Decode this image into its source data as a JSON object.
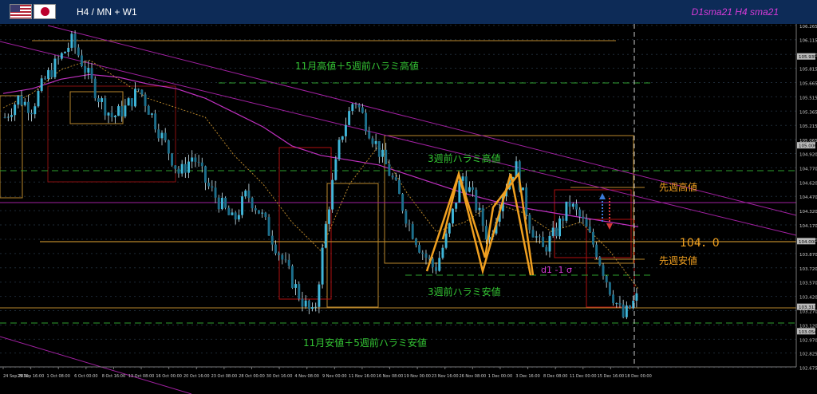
{
  "header": {
    "title": "H4 / MN + W1",
    "legend_d1": "D1sma21",
    "legend_h4": "H4 sma21",
    "flags": [
      "flag-us-icon",
      "flag-jp-icon"
    ]
  },
  "annotations": {
    "nov_high": "11月高値＋5週前ハラミ高値",
    "harami3_high": "3週前ハラミ高値",
    "prev_week_high": "先週高値",
    "level_104": "104．0",
    "prev_week_low": "先週安値",
    "d1_sigma": "d1 -1 σ",
    "harami3_low": "3週前ハラミ安値",
    "nov_low": "11月安値＋5週前ハラミ安値"
  },
  "colors": {
    "background": "#000000",
    "header": "#0d2b57",
    "grid": "#2a3a4a",
    "candle": "#3fb6d9",
    "sma_d1": "#c030c0",
    "sma_h4": "#b8862b",
    "annotation_green": "#33c233",
    "annotation_orange": "#f0a020",
    "dashed_green": "#2ea02e"
  },
  "chart_data": {
    "type": "candlestick",
    "title": "",
    "yaxis": {
      "range": [
        102.68,
        106.28
      ],
      "ticks": [
        "106.265",
        "106.115",
        "105.960",
        "105.815",
        "105.665",
        "105.515",
        "105.365",
        "105.215",
        "105.065",
        "104.920",
        "104.770",
        "104.620",
        "104.470",
        "104.320",
        "104.170",
        "104.020",
        "103.870",
        "103.720",
        "103.570",
        "103.420",
        "103.270",
        "103.120",
        "102.970",
        "102.825",
        "102.675"
      ],
      "price_tags": [
        "105.939",
        "105.006",
        "104.000",
        "103.311",
        "103.054"
      ]
    },
    "xaxis": {
      "labels": [
        "24 Sep 2020",
        "29 Sep 16:00",
        "1 Oct 08:00",
        "6 Oct 00:00",
        "8 Oct 16:00",
        "13 Oct 08:00",
        "16 Oct 00:00",
        "20 Oct 16:00",
        "23 Oct 08:00",
        "28 Oct 00:00",
        "30 Oct 16:00",
        "4 Nov 08:00",
        "9 Nov 00:00",
        "11 Nov 16:00",
        "16 Nov 08:00",
        "19 Nov 00:00",
        "23 Nov 16:00",
        "26 Nov 08:00",
        "1 Dec 00:00",
        "3 Dec 16:00",
        "8 Dec 08:00",
        "11 Dec 00:00",
        "15 Dec 16:00",
        "18 Dec 00:00"
      ]
    },
    "series": [
      {
        "name": "D1sma21",
        "values": [
          105.55,
          105.6,
          105.7,
          105.75,
          105.72,
          105.65,
          105.6,
          105.5,
          105.35,
          105.2,
          105.0,
          104.9,
          104.85,
          104.8,
          104.7,
          104.6,
          104.5,
          104.42,
          104.35,
          104.3,
          104.25,
          104.2,
          104.15
        ]
      },
      {
        "name": "H4 sma21",
        "values": [
          105.4,
          105.55,
          105.8,
          105.9,
          105.7,
          105.5,
          105.4,
          105.3,
          104.9,
          104.6,
          104.2,
          103.9,
          104.6,
          105.0,
          104.5,
          104.1,
          104.2,
          104.4,
          104.3,
          104.1,
          104.2,
          103.9,
          103.5
        ]
      }
    ],
    "close_path": [
      105.3,
      105.5,
      105.4,
      105.7,
      105.9,
      106.1,
      105.8,
      105.5,
      105.3,
      105.4,
      105.6,
      105.3,
      105.0,
      104.7,
      104.9,
      104.6,
      104.4,
      104.2,
      104.5,
      104.3,
      104.0,
      103.7,
      103.4,
      103.2,
      104.3,
      105.1,
      105.5,
      105.2,
      104.9,
      104.6,
      104.2,
      103.9,
      103.7,
      104.1,
      104.7,
      104.4,
      104.0,
      104.5,
      104.8,
      104.2,
      103.9,
      104.1,
      104.4,
      104.2,
      103.9,
      103.5,
      103.2,
      103.4
    ]
  }
}
